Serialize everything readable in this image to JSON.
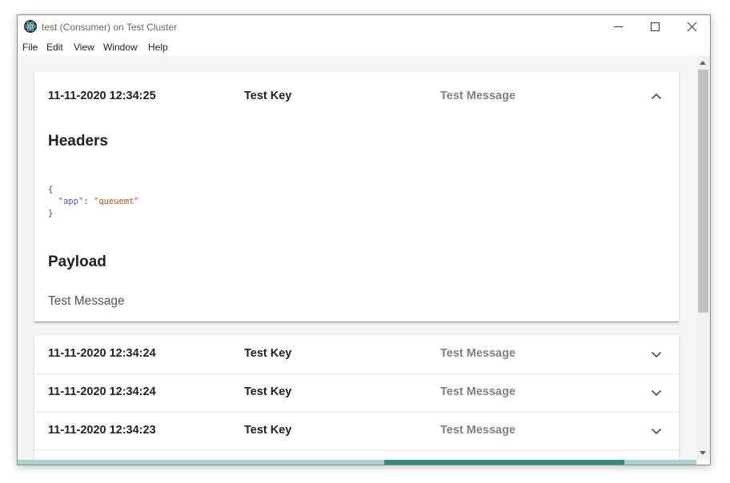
{
  "window": {
    "title": "test (Consumer) on Test Cluster"
  },
  "menu": [
    "File",
    "Edit",
    "View",
    "Window",
    "Help"
  ],
  "expanded_message": {
    "timestamp": "11-11-2020 12:34:25",
    "key": "Test Key",
    "preview": "Test Message",
    "headers_title": "Headers",
    "headers_json": {
      "open": "{",
      "key": "\"app\"",
      "sep": ": ",
      "value": "\"queuemt\"",
      "close": "}"
    },
    "payload_title": "Payload",
    "payload": "Test Message"
  },
  "messages": [
    {
      "timestamp": "11-11-2020 12:34:24",
      "key": "Test Key",
      "preview": "Test Message"
    },
    {
      "timestamp": "11-11-2020 12:34:24",
      "key": "Test Key",
      "preview": "Test Message"
    },
    {
      "timestamp": "11-11-2020 12:34:23",
      "key": "Test Key",
      "preview": "Test Message"
    }
  ],
  "icons": {
    "app": "electron-icon",
    "collapse": "chevron-up-icon",
    "expand": "chevron-down-icon"
  },
  "colors": {
    "progress_track": "#a5d2cd",
    "progress_fill": "#2d8c80"
  }
}
